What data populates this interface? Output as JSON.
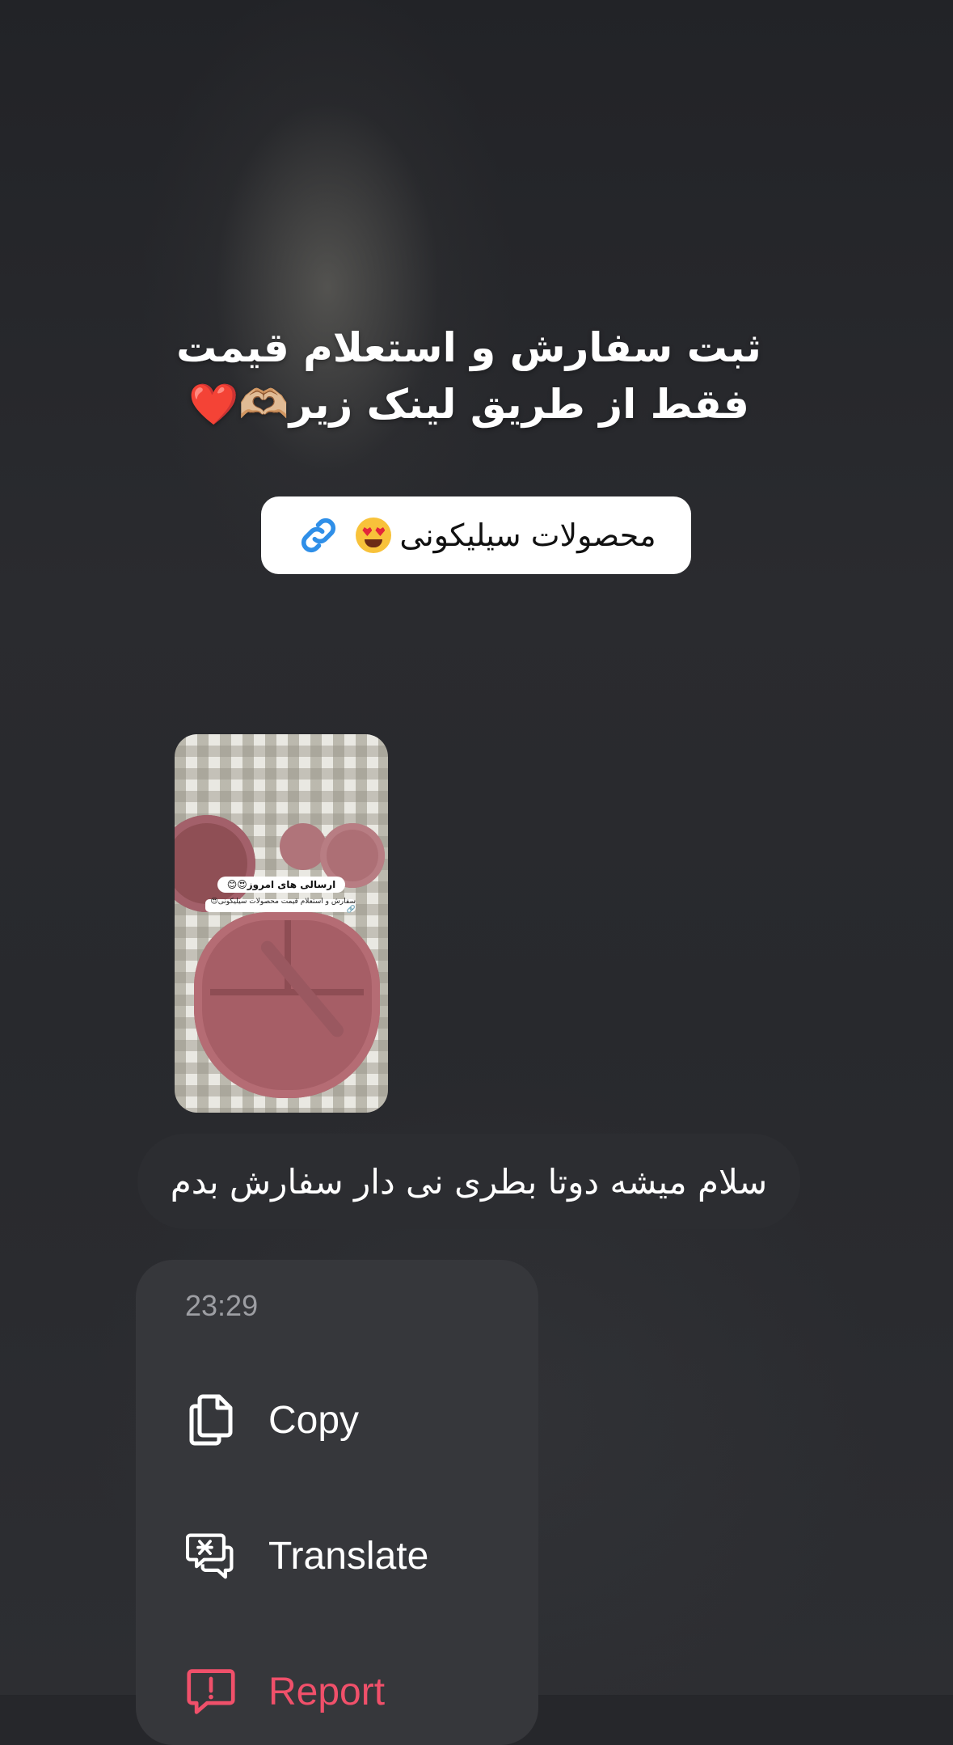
{
  "story": {
    "title_line1": "ثبت سفارش و استعلام قیمت",
    "title_line2": "فقط از طریق لینک زیر🫶🏼❤️",
    "link_sticker_label": "محصولات سیلیکونی"
  },
  "shared_post": {
    "caption_top": "ارسالی های امروز😍😊",
    "caption_bottom": "سفارش و استعلام قیمت محصولات سیلیکونی😍 🔗"
  },
  "message": {
    "text": "سلام میشه دوتا بطری نی دار سفارش بدم"
  },
  "context_menu": {
    "time": "23:29",
    "items": [
      {
        "label": "Copy",
        "icon": "copy-icon"
      },
      {
        "label": "Translate",
        "icon": "translate-icon"
      },
      {
        "label": "Report",
        "icon": "report-icon",
        "color": "#f0506a"
      }
    ]
  }
}
